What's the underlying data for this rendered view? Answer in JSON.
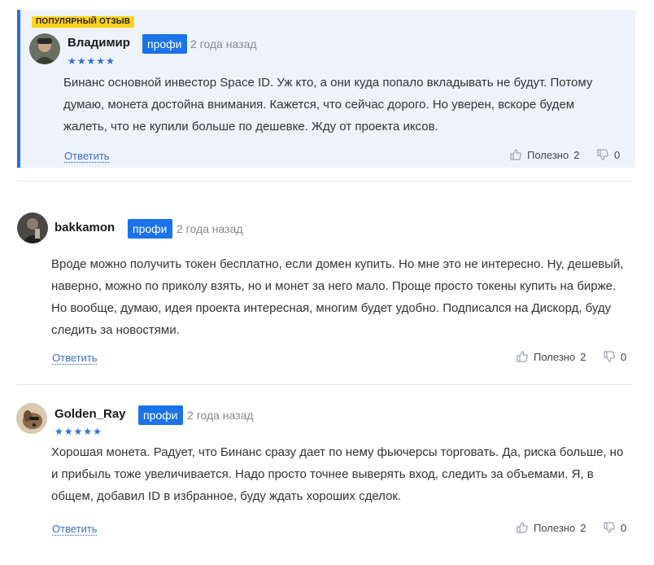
{
  "labels": {
    "popular": "ПОПУЛЯРНЫЙ ОТЗЫВ",
    "pro": "профи",
    "reply": "Ответить",
    "useful": "Полезно"
  },
  "reviews": [
    {
      "author": "Владимир",
      "date": "2 года назад",
      "stars": 5,
      "text": "Бинанс основной инвестор Space ID. Уж кто, а они куда попало вкладывать не будут. Потому думаю, монета достойна внимания. Кажется, что сейчас дорого. Но уверен, вскоре будем жалеть, что не купили больше по дешевке. Жду от проекта иксов.",
      "likes": "2",
      "dislikes": "0"
    },
    {
      "author": "bakkamon",
      "date": "2 года назад",
      "text": "Вроде можно получить токен бесплатно, если домен купить. Но мне это не интересно. Ну, дешевый, наверно, можно по приколу взять, но и монет за него мало. Проще просто токены купить на бирже. Но вообще, думаю, идея проекта интересная, многим будет удобно. Подписался на Дискорд, буду следить за новостями.",
      "likes": "2",
      "dislikes": "0"
    },
    {
      "author": "Golden_Ray",
      "date": "2 года назад",
      "stars": 5,
      "text": "Хорошая монета. Радует, что Бинанс сразу дает по нему фьючерсы торговать. Да, риска больше, но и прибыль тоже увеличивается. Надо просто точнее выверять вход, следить за объемами. Я, в общем, добавил ID в избранное, буду ждать хороших сделок.",
      "likes": "2",
      "dislikes": "0"
    }
  ]
}
